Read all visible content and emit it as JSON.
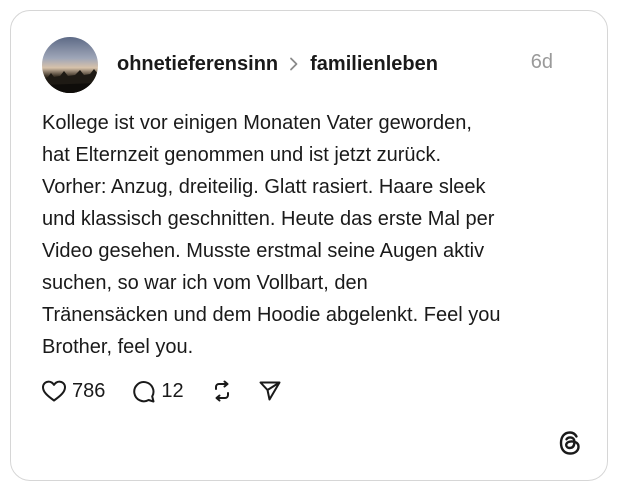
{
  "post": {
    "username": "ohnetieferensinn",
    "topic": "familienleben",
    "age": "6d",
    "text": "Kollege ist vor einigen Monaten Vater geworden,\nhat Elternzeit genommen und ist jetzt zurück.\nVorher: Anzug, dreiteilig. Glatt rasiert. Haare sleek\nund klassisch geschnitten. Heute das erste Mal per\nVideo gesehen. Musste erstmal seine Augen aktiv\nsuchen, so war ich  vom Vollbart, den\nTränensäcken und dem Hoodie abgelenkt. Feel you\nBrother, feel you."
  },
  "actions": {
    "likes": "786",
    "replies": "12"
  },
  "icons": {
    "like": "heart-icon",
    "reply": "comment-icon",
    "repost": "repost-icon",
    "share": "send-icon",
    "brand": "threads-logo-icon"
  },
  "colors": {
    "text": "#1a1a1a",
    "muted": "#9a9a9a",
    "border": "#d6d6d6"
  }
}
